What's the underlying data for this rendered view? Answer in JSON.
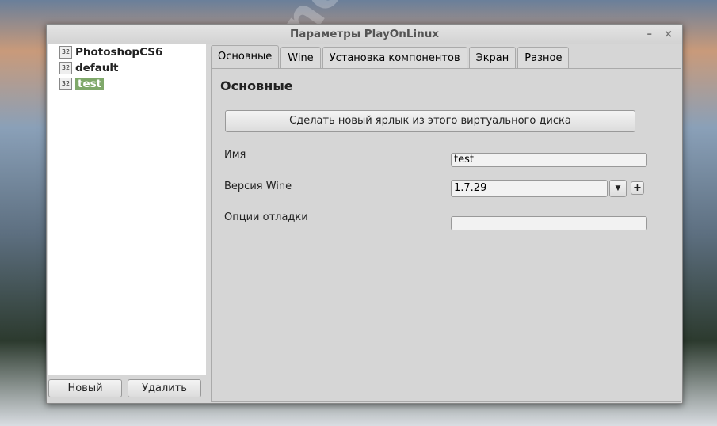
{
  "window": {
    "title": "Параметры PlayOnLinux",
    "minimize": "–",
    "close": "×"
  },
  "sidebar": {
    "items": [
      {
        "label": "PhotoshopCS6",
        "icon": "32"
      },
      {
        "label": "default",
        "icon": "32"
      },
      {
        "label": "test",
        "icon": "32",
        "selected": true
      }
    ],
    "new_label": "Новый",
    "delete_label": "Удалить"
  },
  "tabs": [
    {
      "label": "Основные",
      "active": true
    },
    {
      "label": "Wine"
    },
    {
      "label": "Установка компонентов"
    },
    {
      "label": "Экран"
    },
    {
      "label": "Разное"
    }
  ],
  "main": {
    "heading": "Основные",
    "shortcut_button": "Сделать новый ярлык из этого виртуального диска",
    "name_label": "Имя",
    "name_value": "test",
    "wine_label": "Версия Wine",
    "wine_value": "1.7.29",
    "debug_label": "Опции отладки",
    "debug_value": ""
  },
  "watermark": "codeby.net",
  "colors": {
    "selection": "#7fa86a"
  }
}
